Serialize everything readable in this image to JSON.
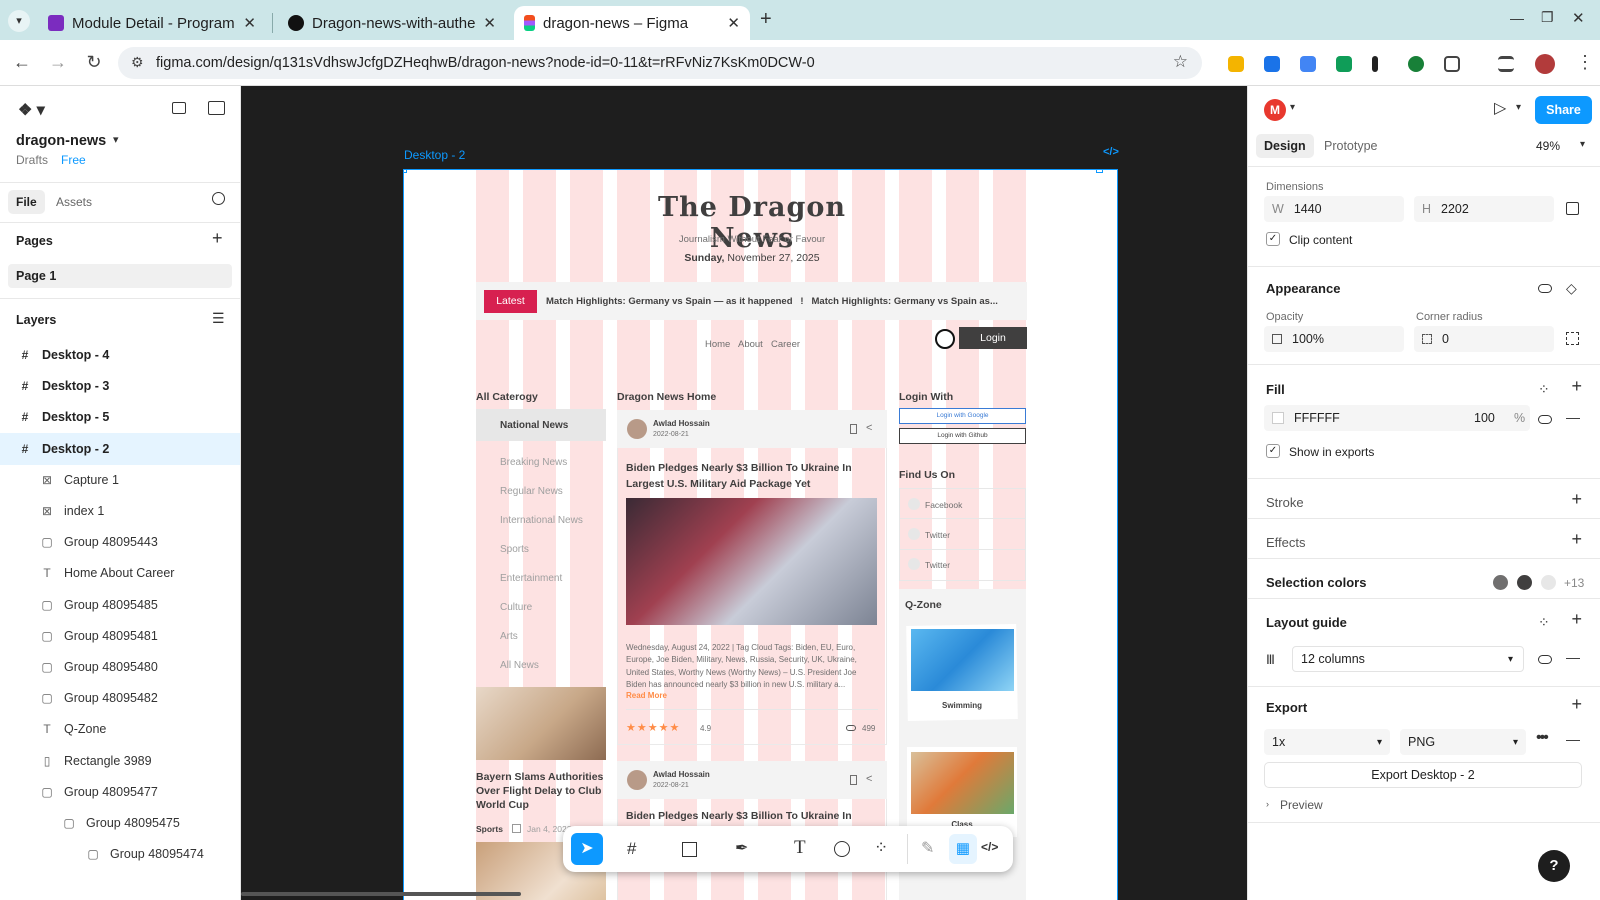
{
  "browser": {
    "tabs": [
      {
        "title": "Module Detail - Program"
      },
      {
        "title": "Dragon-news-with-authe"
      },
      {
        "title": "dragon-news – Figma"
      }
    ],
    "url": "figma.com/design/q131sVdhswJcfgDZHeqhwB/dragon-news?node-id=0-11&t=rRFvNiz7KsKm0DCW-0"
  },
  "figma": {
    "file_name": "dragon-news",
    "drafts": "Drafts",
    "plan": "Free",
    "tabs": {
      "file": "File",
      "assets": "Assets"
    },
    "pages_header": "Pages",
    "page": "Page 1",
    "layers_header": "Layers",
    "layers": [
      {
        "name": "Desktop - 4",
        "type": "frame"
      },
      {
        "name": "Desktop - 3",
        "type": "frame"
      },
      {
        "name": "Desktop - 5",
        "type": "frame"
      },
      {
        "name": "Desktop - 2",
        "type": "frame"
      },
      {
        "name": "Capture 1",
        "type": "image"
      },
      {
        "name": "index 1",
        "type": "image"
      },
      {
        "name": "Group 48095443",
        "type": "group"
      },
      {
        "name": "Home About Career",
        "type": "text"
      },
      {
        "name": "Group 48095485",
        "type": "group"
      },
      {
        "name": "Group 48095481",
        "type": "group"
      },
      {
        "name": "Group 48095480",
        "type": "group"
      },
      {
        "name": "Group 48095482",
        "type": "group"
      },
      {
        "name": "Q-Zone",
        "type": "text"
      },
      {
        "name": "Rectangle 3989",
        "type": "rect"
      },
      {
        "name": "Group 48095477",
        "type": "group"
      },
      {
        "name": "Group 48095475",
        "type": "group"
      },
      {
        "name": "Group 48095474",
        "type": "group"
      }
    ],
    "frame_label": "Desktop - 2",
    "user_initial": "M",
    "share": "Share",
    "right_tabs": {
      "design": "Design",
      "prototype": "Prototype"
    },
    "zoom": "49%",
    "dimensions_label": "Dimensions",
    "width_label": "W",
    "width": "1440",
    "height_label": "H",
    "height": "2202",
    "clip_content": "Clip content",
    "appearance": "Appearance",
    "opacity_label": "Opacity",
    "opacity": "100%",
    "corner_label": "Corner radius",
    "corner": "0",
    "fill": "Fill",
    "fill_hex": "FFFFFF",
    "fill_opacity": "100",
    "percent": "%",
    "show_exports": "Show in exports",
    "stroke": "Stroke",
    "effects": "Effects",
    "selection_colors": "Selection colors",
    "selection_more": "+13",
    "layout_guide": "Layout guide",
    "columns": "12 columns",
    "export": "Export",
    "scale": "1x",
    "format": "PNG",
    "export_btn": "Export Desktop - 2",
    "preview": "Preview",
    "help": "?"
  },
  "design": {
    "title": "The Dragon News",
    "tagline": "Journalism Without Fear or Favour",
    "date_day": "Sunday,",
    "date_rest": " November 27, 2025",
    "latest": "Latest",
    "ticker": "Match Highlights: Germany vs Spain — as it happened   !   Match Highlights: Germany vs Spain as...",
    "nav": [
      "Home",
      "About",
      "Career"
    ],
    "login": "Login",
    "all_category": "All Caterogy",
    "categories": [
      "National News",
      "Breaking News",
      "Regular News",
      "International News",
      "Sports",
      "Entertainment",
      "Culture",
      "Arts",
      "All News"
    ],
    "home_heading": "Dragon News Home",
    "author": "Awlad Hossain",
    "post_date": "2022-08-21",
    "headline": "Biden Pledges Nearly $3 Billion To Ukraine In Largest U.S. Military Aid Package Yet",
    "headline2": "Biden Pledges Nearly $3 Billion To Ukraine In",
    "body": "Wednesday, August 24, 2022 | Tag Cloud Tags: Biden, EU, Euro, Europe, Joe Biden, Military, News, Russia, Security, UK, Ukraine, United States, Worthy News (Worthy News) – U.S. President Joe Biden has announced nearly $3 billion in new U.S. military a...",
    "read_more": "Read More",
    "rating": "4.9",
    "views": "499",
    "side_story": "Bayern Slams Authorities Over Flight Delay to Club World Cup",
    "side_tag": "Sports",
    "side_date": "Jan 4, 2022",
    "login_with": "Login With",
    "login_google": "Login with Google",
    "login_github": "Login with Github",
    "find_us": "Find Us On",
    "socials": [
      "Facebook",
      "Twitter",
      "Twitter"
    ],
    "qzone": "Q-Zone",
    "swimming": "Swimming",
    "class": "Class"
  },
  "colors": {
    "accent": "#D72050",
    "figma_blue": "#0d99ff",
    "stripe": "#fde2e2"
  }
}
